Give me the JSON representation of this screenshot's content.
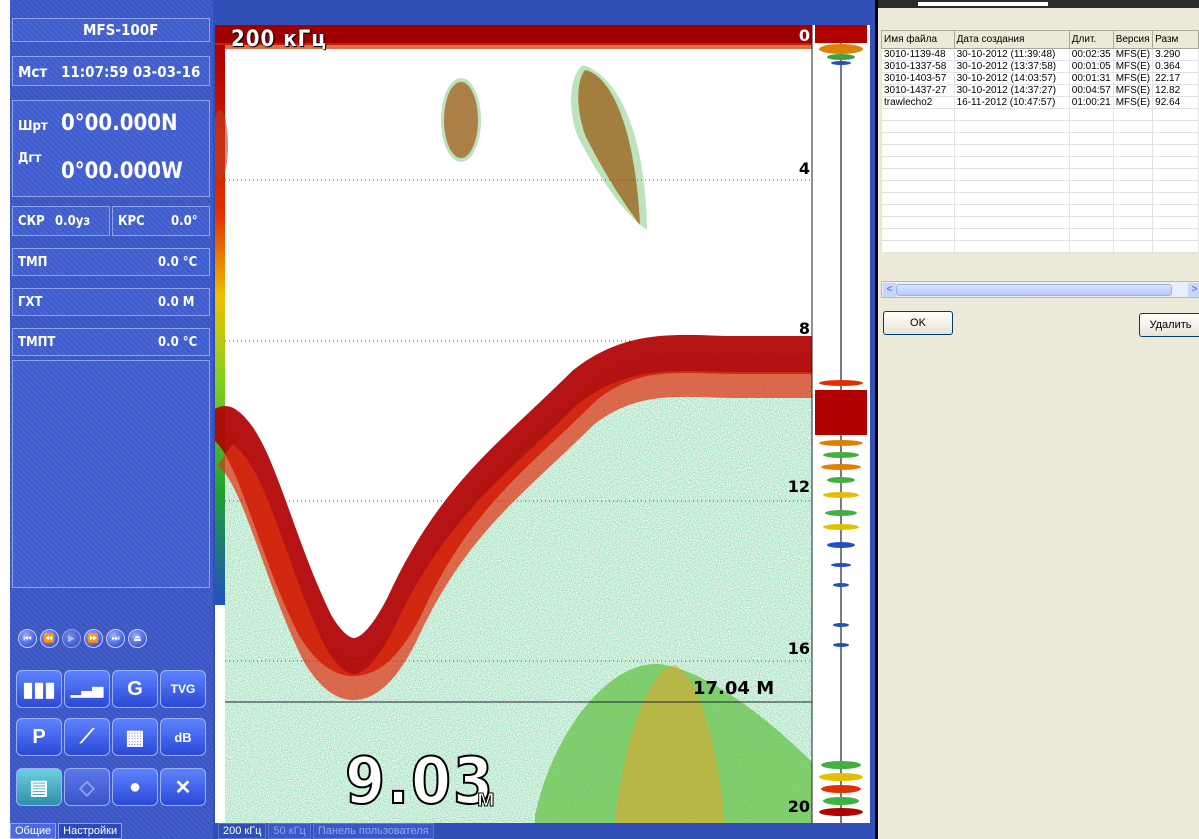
{
  "left_panel": {
    "model": "MFS-100F",
    "time_label": "Мст",
    "time_value": "11:07:59 03-03-16",
    "lat_label": "Шрт",
    "lat_value": "0°00.000N",
    "lon_label": "Дгт",
    "lon_value": "0°00.000W",
    "speed_label": "СКР",
    "speed_value": "0.0уз",
    "course_label": "КРС",
    "course_value": "0.0°",
    "readings": [
      {
        "label": "ТМП",
        "value": "0.0 °C"
      },
      {
        "label": "ГХТ",
        "value": "0.0 M"
      },
      {
        "label": "ТМПТ",
        "value": "0.0 °C"
      }
    ],
    "playback_icons": [
      "skip-back-icon",
      "rewind-icon",
      "play-icon",
      "fast-forward-icon",
      "skip-forward-icon",
      "eject-icon"
    ],
    "func_buttons": [
      {
        "name": "bars-mode-icon",
        "glyph": "▮▮▮"
      },
      {
        "name": "bars-rising-icon",
        "glyph": "▁▃▅"
      },
      {
        "name": "gain-icon",
        "glyph": "G"
      },
      {
        "name": "tvg-icon",
        "label": "TVG"
      },
      {
        "name": "power-icon",
        "glyph": "P"
      },
      {
        "name": "slope-icon",
        "glyph": "⟋"
      },
      {
        "name": "chart-adjust-icon",
        "glyph": "▦"
      },
      {
        "name": "db-signal-icon",
        "label": "dB"
      },
      {
        "name": "document-icon",
        "glyph": "▤"
      },
      {
        "name": "eraser-icon",
        "glyph": "◇"
      },
      {
        "name": "user-icon",
        "glyph": "●"
      },
      {
        "name": "tools-icon",
        "glyph": "✕"
      }
    ],
    "tabs": [
      "Общие",
      "Настройки"
    ]
  },
  "echogram": {
    "frequency": "200 кГц",
    "depth_scale": [
      "0",
      "4",
      "8",
      "12",
      "16",
      "20"
    ],
    "cursor_depth": "17.04 M",
    "current_depth": "9.03",
    "depth_unit": "м",
    "bottom_tabs": [
      "200 кГц",
      "50 кГц",
      "Панель пользователя"
    ]
  },
  "file_dialog": {
    "columns": [
      "Имя файла",
      "Дата создания",
      "Длит.",
      "Версия",
      "Разм"
    ],
    "rows": [
      [
        "3010-1139-48",
        "30-10-2012 (11:39:48)",
        "00:02:35",
        "MFS(E)",
        "3.290"
      ],
      [
        "3010-1337-58",
        "30-10-2012 (13:37:58)",
        "00:01:05",
        "MFS(E)",
        "0.364"
      ],
      [
        "3010-1403-57",
        "30-10-2012 (14:03:57)",
        "00:01:31",
        "MFS(E)",
        "22.17"
      ],
      [
        "3010-1437-27",
        "30-10-2012 (14:37:27)",
        "00:04:57",
        "MFS(E)",
        "12.82"
      ],
      [
        "trawlecho2",
        "16-11-2012 (10:47:57)",
        "01:00:21",
        "MFS(E)",
        "92.64"
      ]
    ],
    "ok_label": "OK",
    "delete_label": "Удалить"
  }
}
